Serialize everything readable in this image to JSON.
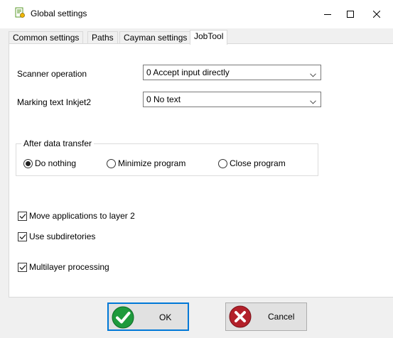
{
  "window": {
    "title": "Global settings",
    "app_icon": "settings-sheet-icon",
    "controls": [
      "minimize-icon",
      "maximize-icon",
      "close-icon"
    ]
  },
  "tabs": [
    {
      "label": "Common settings",
      "active": false
    },
    {
      "label": "Paths",
      "active": false
    },
    {
      "label": "Cayman settings",
      "active": false
    },
    {
      "label": "JobTool",
      "active": true
    }
  ],
  "form": {
    "scanner": {
      "label": "Scanner operation",
      "value": "0 Accept input directly"
    },
    "marking": {
      "label": "Marking text Inkjet2",
      "value": "0 No text"
    },
    "after_transfer": {
      "title": "After data transfer",
      "options": [
        {
          "label": "Do nothing",
          "selected": true
        },
        {
          "label": "Minimize program",
          "selected": false
        },
        {
          "label": "Close program",
          "selected": false
        }
      ]
    },
    "checkboxes": [
      {
        "label": "Move applications to layer 2",
        "checked": true
      },
      {
        "label": "Use subdiretories",
        "checked": true
      },
      {
        "label": "Multilayer processing",
        "checked": true
      }
    ]
  },
  "buttons": {
    "ok": {
      "label": "OK",
      "icon": "checkmark-icon"
    },
    "cancel": {
      "label": "Cancel",
      "icon": "cross-icon"
    }
  },
  "colors": {
    "ok_icon": "#1e9a3c",
    "cancel_icon": "#b3202a",
    "default_border": "#0078d7"
  }
}
